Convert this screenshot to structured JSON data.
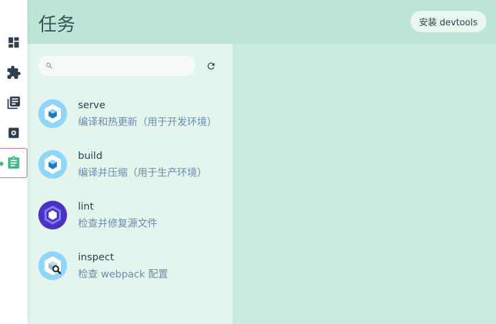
{
  "header": {
    "title": "任务",
    "devtools_button": "安装 devtools"
  },
  "nav": {
    "items": [
      {
        "icon": "dashboard-icon",
        "active": false
      },
      {
        "icon": "puzzle-icon",
        "active": false
      },
      {
        "icon": "library-icon",
        "active": false
      },
      {
        "icon": "gear-icon",
        "active": false
      },
      {
        "icon": "clipboard-icon",
        "active": true
      }
    ]
  },
  "search": {
    "placeholder": "",
    "value": ""
  },
  "tasks": [
    {
      "name": "serve",
      "description": "编译和热更新（用于开发环境）",
      "icon": "webpack-icon"
    },
    {
      "name": "build",
      "description": "编译并压缩（用于生产环境）",
      "icon": "webpack-icon"
    },
    {
      "name": "lint",
      "description": "检查并修复源文件",
      "icon": "eslint-icon"
    },
    {
      "name": "inspect",
      "description": "检查 webpack 配置",
      "icon": "webpack-inspect-icon"
    }
  ],
  "colors": {
    "accent": "#42b983",
    "header_bg": "#bde6d6",
    "list_bg": "#e4f5ee",
    "detail_bg": "#c9ebdf",
    "active_border": "#a36ad6"
  }
}
